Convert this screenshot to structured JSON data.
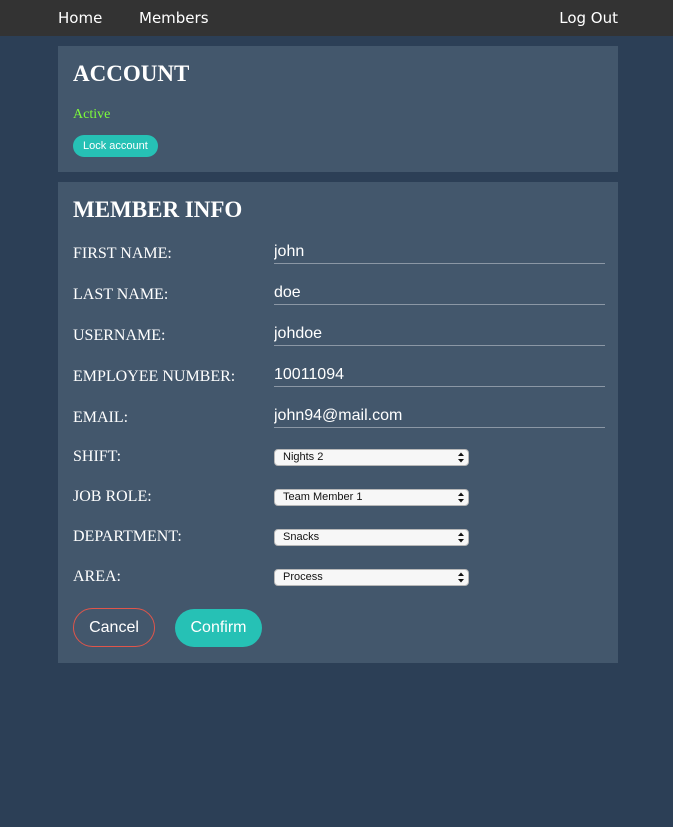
{
  "nav": {
    "home_label": "Home",
    "members_label": "Members",
    "logout_label": "Log Out"
  },
  "account": {
    "title": "ACCOUNT",
    "status": "Active",
    "lock_label": "Lock account"
  },
  "member_info": {
    "title": "MEMBER INFO",
    "fields": {
      "first_name": {
        "label": "FIRST NAME:",
        "value": "john"
      },
      "last_name": {
        "label": "LAST NAME:",
        "value": "doe"
      },
      "username": {
        "label": "USERNAME:",
        "value": "johdoe"
      },
      "employee_number": {
        "label": "EMPLOYEE NUMBER:",
        "value": "10011094"
      },
      "email": {
        "label": "EMAIL:",
        "value": "john94@mail.com"
      }
    },
    "selects": {
      "shift": {
        "label": "SHIFT:",
        "value": "Nights 2"
      },
      "job_role": {
        "label": "JOB ROLE:",
        "value": "Team Member 1"
      },
      "department": {
        "label": "DEPARTMENT:",
        "value": "Snacks"
      },
      "area": {
        "label": "AREA:",
        "value": "Process"
      }
    },
    "cancel_label": "Cancel",
    "confirm_label": "Confirm"
  },
  "colors": {
    "background": "#2c3f56",
    "navbar": "#333333",
    "panel": "#43576c",
    "accent": "#26c1b5",
    "status_active": "#7cfc3a",
    "cancel_border": "#e0554a"
  }
}
